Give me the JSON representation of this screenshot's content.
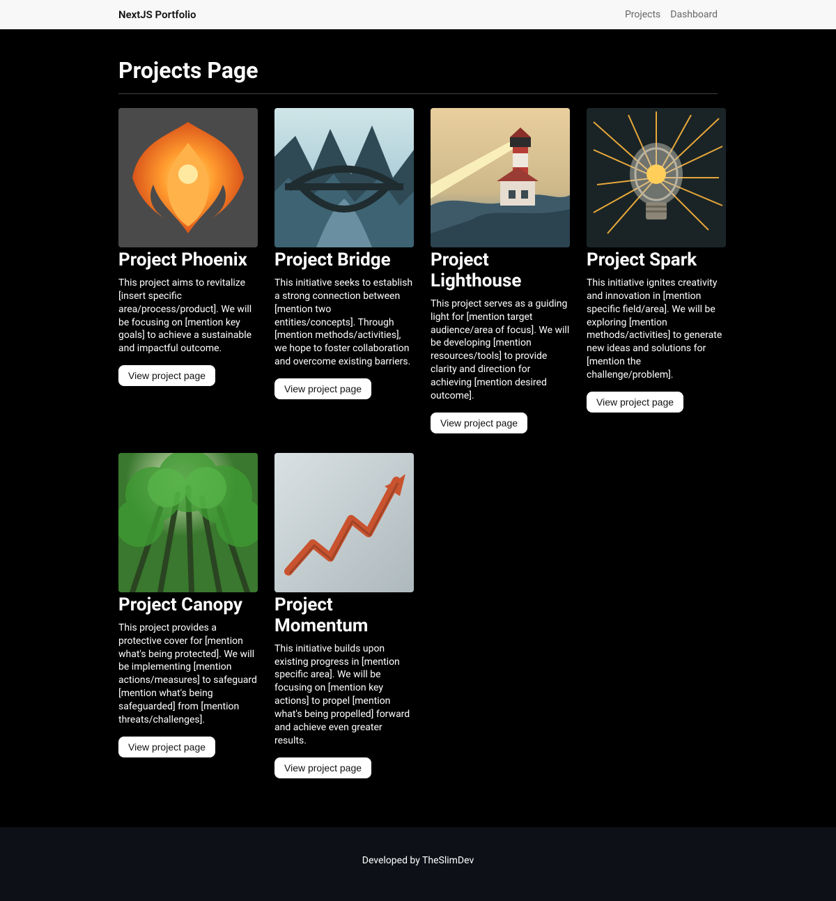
{
  "header": {
    "brand": "NextJS Portfolio",
    "nav": {
      "projects": "Projects",
      "dashboard": "Dashboard"
    }
  },
  "page": {
    "title": "Projects Page",
    "view_button_label": "View project page"
  },
  "projects": [
    {
      "title": "Project Phoenix",
      "description": "This project aims to revitalize [insert specific area/process/product]. We will be focusing on [mention key goals] to achieve a sustainable and impactful outcome.",
      "thumb_icon": "phoenix"
    },
    {
      "title": "Project Bridge",
      "description": "This initiative seeks to establish a strong connection between [mention two entities/concepts]. Through [mention methods/activities], we hope to foster collaboration and overcome existing barriers.",
      "thumb_icon": "bridge"
    },
    {
      "title": "Project Lighthouse",
      "description": "This project serves as a guiding light for [mention target audience/area of focus]. We will be developing [mention resources/tools] to provide clarity and direction for achieving [mention desired outcome].",
      "thumb_icon": "lighthouse"
    },
    {
      "title": "Project Spark",
      "description": "This initiative ignites creativity and innovation in [mention specific field/area]. We will be exploring [mention methods/activities] to generate new ideas and solutions for [mention the challenge/problem].",
      "thumb_icon": "spark"
    },
    {
      "title": "Project Canopy",
      "description": "This project provides a protective cover for [mention what's being protected]. We will be implementing [mention actions/measures] to safeguard [mention what's being safeguarded] from [mention threats/challenges].",
      "thumb_icon": "canopy"
    },
    {
      "title": "Project Momentum",
      "description": "This initiative builds upon existing progress in [mention specific area]. We will be focusing on [mention key actions] to propel [mention what's being propelled] forward and achieve even greater results.",
      "thumb_icon": "momentum"
    }
  ],
  "footer": {
    "text": "Developed by TheSlimDev"
  }
}
